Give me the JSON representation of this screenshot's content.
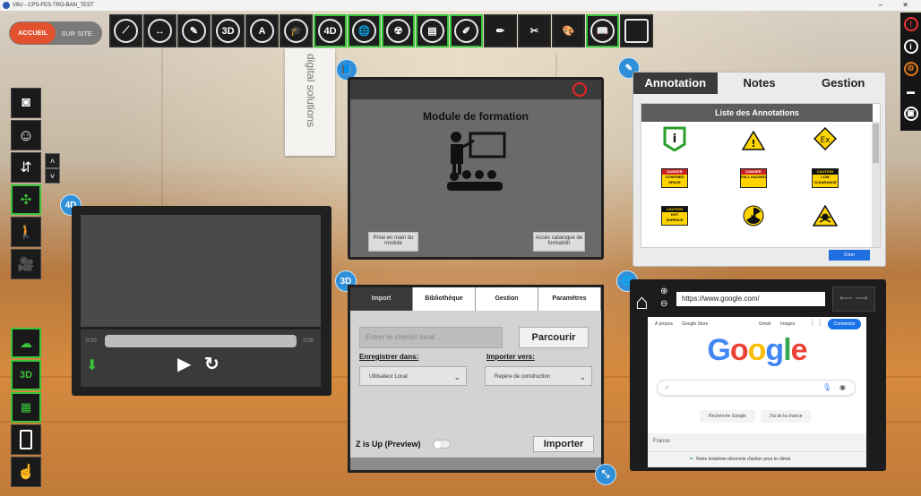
{
  "window": {
    "title": "V6U - CPS-FES-TRO-BAN_TEST",
    "controls": "–  ✕"
  },
  "scene": {
    "sign_text": "digital solutions"
  },
  "mode_toggle": {
    "active": "ACCUEIL",
    "inactive": "SUR SITE"
  },
  "toolbar": {
    "items": [
      {
        "name": "measure-tool",
        "label": ""
      },
      {
        "name": "dimension-tool",
        "label": ""
      },
      {
        "name": "section-tool",
        "label": ""
      },
      {
        "name": "3d-view",
        "label": "3D"
      },
      {
        "name": "annotation-tool",
        "label": "A"
      },
      {
        "name": "training",
        "label": ""
      },
      {
        "name": "4d-view",
        "label": "4D"
      },
      {
        "name": "web-browser",
        "label": ""
      },
      {
        "name": "radiation-tool",
        "label": ""
      },
      {
        "name": "documents",
        "label": ""
      },
      {
        "name": "draw-tool",
        "label": ""
      },
      {
        "name": "pen-tool",
        "label": ""
      },
      {
        "name": "cut-tool",
        "label": ""
      },
      {
        "name": "palette-tool",
        "label": ""
      },
      {
        "name": "library-tool",
        "label": ""
      },
      {
        "name": "tablet-tool",
        "label": ""
      }
    ]
  },
  "video_panel": {
    "badge": "4D",
    "time_start": "0:00",
    "time_end": "0:00"
  },
  "module_panel": {
    "badge": "",
    "title": "Module de formation",
    "btn_left": "Prise en main du module",
    "btn_right": "Accès catalogue de formation"
  },
  "annotation_panel": {
    "tabs": [
      "Annotation",
      "Notes",
      "Gestion"
    ],
    "list_title": "Liste des Annotations",
    "create_label": "Créer",
    "signs": [
      {
        "top": "DANGER",
        "text": "CONFINED SPACE"
      },
      {
        "top": "DANGER",
        "text": "FALL HAZARD"
      },
      {
        "top": "CAUTION",
        "text": "LOW CLEARANCE"
      },
      {
        "top": "CAUTION",
        "text": "HOT SURFACE"
      }
    ]
  },
  "import_panel": {
    "badge": "3D",
    "tabs": [
      "Import",
      "Bibliothèque",
      "Gestion",
      "Paramètres"
    ],
    "path_placeholder": "Entrer le chemin local ...",
    "browse_label": "Parcourir",
    "save_in_label": "Enregistrer dans:",
    "save_in_value": "Utilisateur Local",
    "import_to_label": "Importer vers:",
    "import_to_value": "Repère de construction",
    "z_up_label": "Z is Up (Preview)",
    "import_label": "Importer"
  },
  "browser_panel": {
    "url": "https://www.google.com/",
    "nav": "⟵  ⟶",
    "top_left": [
      "À propos",
      "Google Store"
    ],
    "top_right": [
      "Gmail",
      "Images"
    ],
    "connect_label": "Connexion",
    "logo": "Google",
    "btn_search": "Recherche Google",
    "btn_lucky": "J'ai de la chance",
    "country": "France",
    "footer_msg": "Notre troisième décennie d'action pour le climat"
  },
  "colors": {
    "accent": "#e2522e",
    "green": "#39c43b",
    "blue": "#2f8fd8",
    "google_blue": "#1a73e8"
  }
}
